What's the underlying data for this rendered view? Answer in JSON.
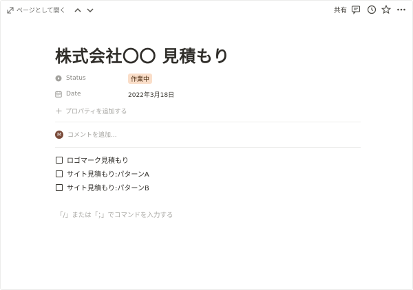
{
  "topbar": {
    "open_as_page": "ページとして開く",
    "share": "共有",
    "icons": [
      "open-page-icon",
      "chevron-up-icon",
      "chevron-down-icon",
      "comment-icon",
      "clock-icon",
      "star-icon",
      "more-icon"
    ]
  },
  "page": {
    "title": "株式会社〇〇 見積もり",
    "properties": {
      "status": {
        "label": "Status",
        "value": "作業中",
        "badge_color": "#fadec9"
      },
      "date": {
        "label": "Date",
        "value": "2022年3月18日"
      },
      "add_property": "プロパティを追加する"
    },
    "comment": {
      "avatar_initial": "M",
      "placeholder": "コメントを追加..."
    },
    "todos": [
      {
        "label": "ロゴマーク見積もり",
        "checked": false
      },
      {
        "label": "サイト見積もり:パターンA",
        "checked": false
      },
      {
        "label": "サイト見積もり:パターンB",
        "checked": false
      }
    ],
    "command_placeholder": "「/」または「；」でコマンドを入力する"
  }
}
